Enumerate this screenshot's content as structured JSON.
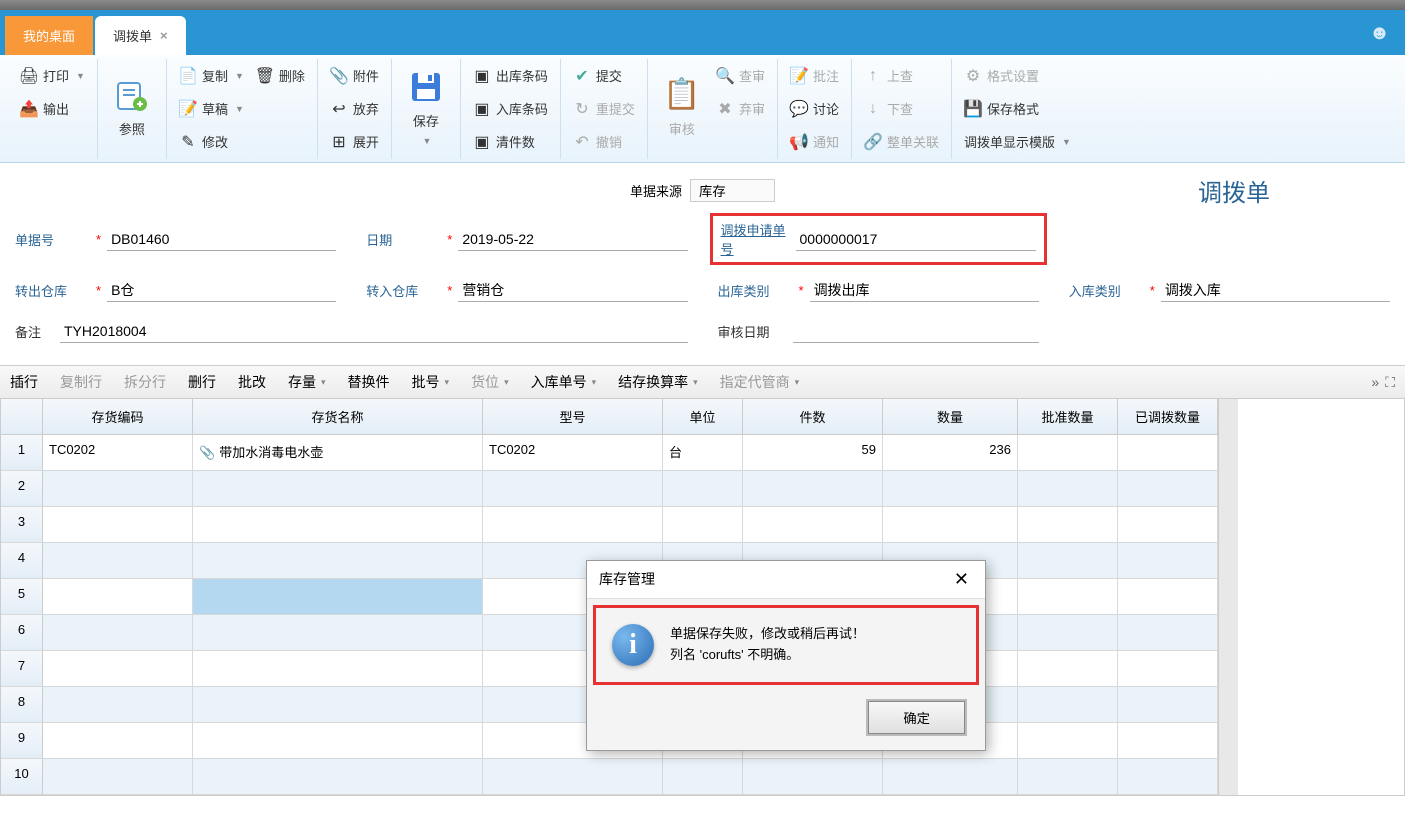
{
  "tabs": {
    "home": "我的桌面",
    "active": "调拨单",
    "smiley": "☻"
  },
  "ribbon": {
    "print": "打印",
    "export": "输出",
    "ref": "参照",
    "copy": "复制",
    "draft": "草稿",
    "edit": "修改",
    "delete": "删除",
    "attach": "附件",
    "discard": "放弃",
    "expand": "展开",
    "save": "保存",
    "outbar": "出库条码",
    "inbar": "入库条码",
    "clearqty": "清件数",
    "submit": "提交",
    "resubmit": "重提交",
    "revoke": "撤销",
    "audit": "审核",
    "review": "查审",
    "abandon": "弃审",
    "note": "批注",
    "discuss": "讨论",
    "notify": "通知",
    "up": "上查",
    "down": "下查",
    "linkall": "整单关联",
    "format": "格式设置",
    "savefmt": "保存格式",
    "template": "调拨单显示模版"
  },
  "form": {
    "source_label": "单据来源",
    "source_value": "库存",
    "doc_title": "调拨单",
    "docno_label": "单据号",
    "docno": "DB01460",
    "date_label": "日期",
    "date": "2019-05-22",
    "reqno_label": "调拨申请单号",
    "reqno": "0000000017",
    "outwh_label": "转出仓库",
    "outwh": "B仓",
    "inwh_label": "转入仓库",
    "inwh": "营销仓",
    "outtype_label": "出库类别",
    "outtype": "调拨出库",
    "intype_label": "入库类别",
    "intype": "调拨入库",
    "remark_label": "备注",
    "remark": "TYH2018004",
    "auditdate_label": "审核日期",
    "auditdate": ""
  },
  "gridbar": {
    "insert": "插行",
    "copyrow": "复制行",
    "splitrow": "拆分行",
    "delrow": "删行",
    "batchmod": "批改",
    "stock": "存量",
    "replace": "替换件",
    "batch": "批号",
    "loc": "货位",
    "inno": "入库单号",
    "conv": "结存换算率",
    "agent": "指定代管商"
  },
  "columns": {
    "code": "存货编码",
    "name": "存货名称",
    "model": "型号",
    "unit": "单位",
    "pieces": "件数",
    "qty": "数量",
    "apprqty": "批准数量",
    "allocqty": "已调拨数量"
  },
  "rows": [
    {
      "n": "1",
      "code": "TC0202",
      "name": "带加水消毒电水壶",
      "model": "TC0202",
      "unit": "台",
      "pieces": "59",
      "qty": "236"
    },
    {
      "n": "2"
    },
    {
      "n": "3"
    },
    {
      "n": "4"
    },
    {
      "n": "5"
    },
    {
      "n": "6"
    },
    {
      "n": "7"
    },
    {
      "n": "8"
    },
    {
      "n": "9"
    },
    {
      "n": "10"
    }
  ],
  "dialog": {
    "title": "库存管理",
    "line1": "单据保存失败，修改或稍后再试！",
    "line2": "列名 'corufts' 不明确。",
    "ok": "确定"
  }
}
